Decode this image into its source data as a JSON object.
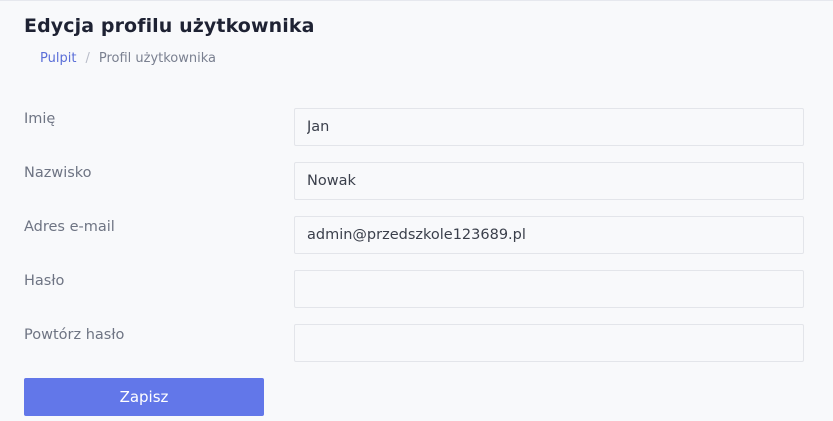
{
  "page": {
    "title": "Edycja profilu użytkownika"
  },
  "breadcrumb": {
    "home": "Pulpit",
    "separator": "/",
    "current": "Profil użytkownika"
  },
  "form": {
    "first_name": {
      "label": "Imię",
      "value": "Jan"
    },
    "last_name": {
      "label": "Nazwisko",
      "value": "Nowak"
    },
    "email": {
      "label": "Adres e-mail",
      "value": "admin@przedszkole123689.pl"
    },
    "password": {
      "label": "Hasło",
      "value": ""
    },
    "password_repeat": {
      "label": "Powtórz hasło",
      "value": ""
    },
    "submit_label": "Zapisz"
  },
  "colors": {
    "accent": "#6277e9",
    "link": "#5b6fd8",
    "title": "#1e2233",
    "label": "#6e7483"
  }
}
